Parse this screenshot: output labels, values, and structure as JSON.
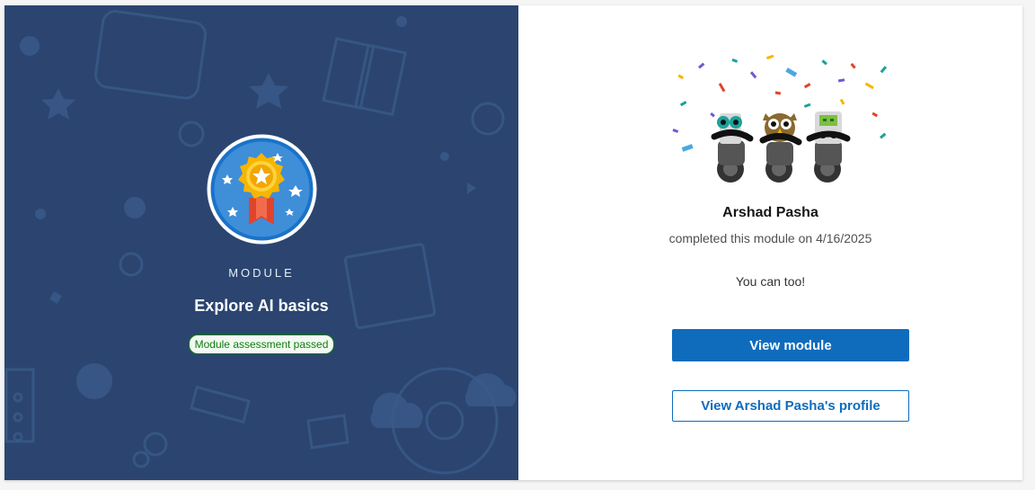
{
  "module": {
    "kicker": "MODULE",
    "title": "Explore AI basics",
    "status": "Module assessment passed"
  },
  "achievement": {
    "user_name": "Arshad Pasha",
    "completed_text": "completed this module on 4/16/2025",
    "encouragement": "You can too!"
  },
  "actions": {
    "view_module": "View module",
    "view_profile": "View Arshad Pasha's profile"
  },
  "icons": {
    "badge": "trophy-medal-icon",
    "illustration": "celebrating-robots-illustration"
  },
  "colors": {
    "left_panel_bg": "#2b4570",
    "primary_button": "#0f6cbd",
    "status_green": "#107c10"
  }
}
